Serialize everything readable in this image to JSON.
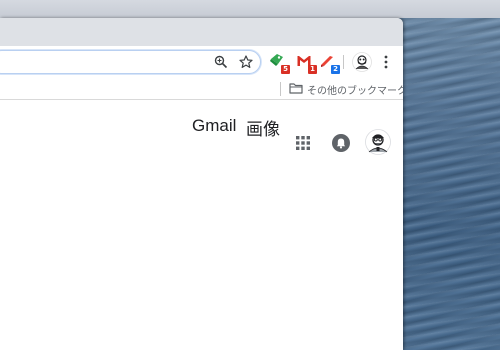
{
  "browser": {
    "extensions": [
      {
        "icon": "green-tag-icon",
        "badge": "5",
        "badge_color": "#d93025"
      },
      {
        "icon": "gmail-icon",
        "badge": "1",
        "badge_color": "#d93025"
      },
      {
        "icon": "red-pen-icon",
        "badge": "2",
        "badge_color": "#1a73e8"
      }
    ],
    "bookmarks_bar": {
      "other_bookmarks_label": "その他のブックマーク"
    }
  },
  "google_header": {
    "gmail_label": "Gmail",
    "images_label": "画像"
  },
  "colors": {
    "titlebar": "#dee1e6",
    "omnibox_border": "#b9d0f1",
    "gmail_red": "#d93025",
    "badge_blue": "#1a73e8"
  }
}
